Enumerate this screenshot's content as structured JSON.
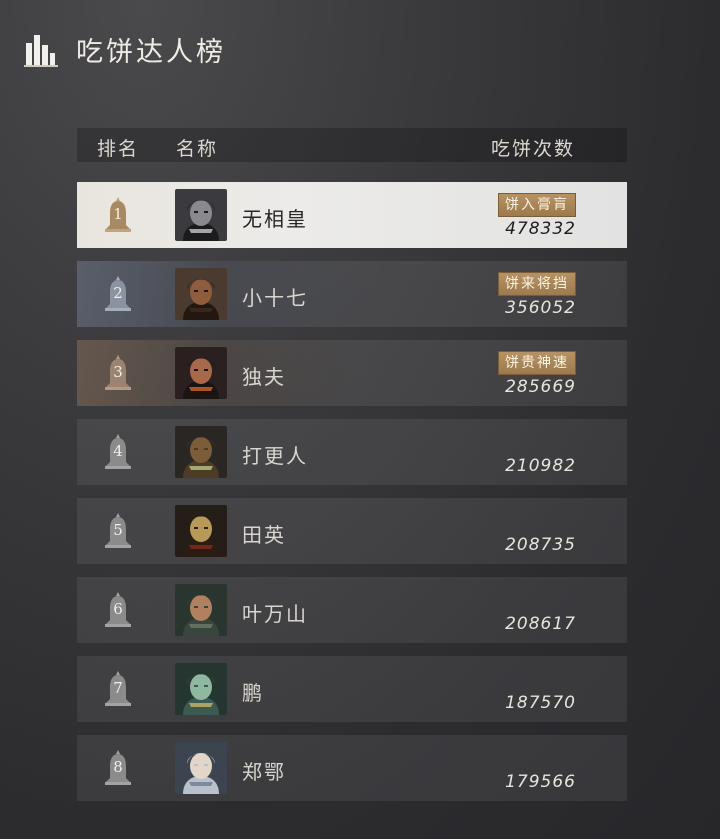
{
  "header": {
    "title": "吃饼达人榜",
    "icon": "leaderboard-bars-icon"
  },
  "columns": {
    "rank": "排名",
    "name": "名称",
    "count": "吃饼次数"
  },
  "colors": {
    "badge": "#a8855a",
    "top1_row": "#e6e4e0",
    "top2_tint": "#6e788c",
    "top3_tint": "#96785f"
  },
  "players": [
    {
      "rank": "1",
      "name": "无相皇",
      "badge": "饼入膏肓",
      "count": "478332",
      "avatar": "masked-warrior-avatar"
    },
    {
      "rank": "2",
      "name": "小十七",
      "badge": "饼来将挡",
      "count": "356052",
      "avatar": "long-hair-man-avatar"
    },
    {
      "rank": "3",
      "name": "独夫",
      "badge": "饼贵神速",
      "count": "285669",
      "avatar": "warrior-avatar"
    },
    {
      "rank": "4",
      "name": "打更人",
      "badge": "",
      "count": "210982",
      "avatar": "bell-avatar"
    },
    {
      "rank": "5",
      "name": "田英",
      "badge": "",
      "count": "208735",
      "avatar": "masked-figure-avatar"
    },
    {
      "rank": "6",
      "name": "叶万山",
      "badge": "",
      "count": "208617",
      "avatar": "helmet-warrior-avatar"
    },
    {
      "rank": "7",
      "name": "鹏",
      "badge": "",
      "count": "187570",
      "avatar": "green-mask-avatar"
    },
    {
      "rank": "8",
      "name": "郑鄂",
      "badge": "",
      "count": "179566",
      "avatar": "silver-hair-avatar"
    }
  ]
}
